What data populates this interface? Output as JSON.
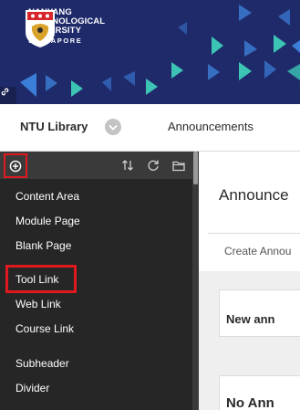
{
  "banner": {
    "university_lines": [
      "NANYANG",
      "TECHNOLOGICAL",
      "UNIVERSITY"
    ],
    "country": "SINGAPORE",
    "colors": {
      "background": "#1f2a6b",
      "accent_teal": "#3cc4b4",
      "accent_blue": "#3c7fd8"
    }
  },
  "navbar": {
    "course_name": "NTU Library",
    "tab_label": "Announcements"
  },
  "course_menu": {
    "toolbar_icons": [
      "add-icon",
      "reorder-icon",
      "refresh-icon",
      "folder-icon"
    ],
    "items": [
      {
        "label": "Content Area"
      },
      {
        "label": "Module Page"
      },
      {
        "label": "Blank Page"
      },
      {
        "label": "Tool Link"
      },
      {
        "label": "Web Link"
      },
      {
        "label": "Course Link"
      },
      {
        "label": "Subheader"
      },
      {
        "label": "Divider"
      }
    ],
    "highlighted_item": "Tool Link",
    "highlight_color": "#e0191f"
  },
  "content": {
    "heading": "Announce",
    "create_button": "Create Annou",
    "card_title": "New ann",
    "card2_title": "No Ann"
  }
}
